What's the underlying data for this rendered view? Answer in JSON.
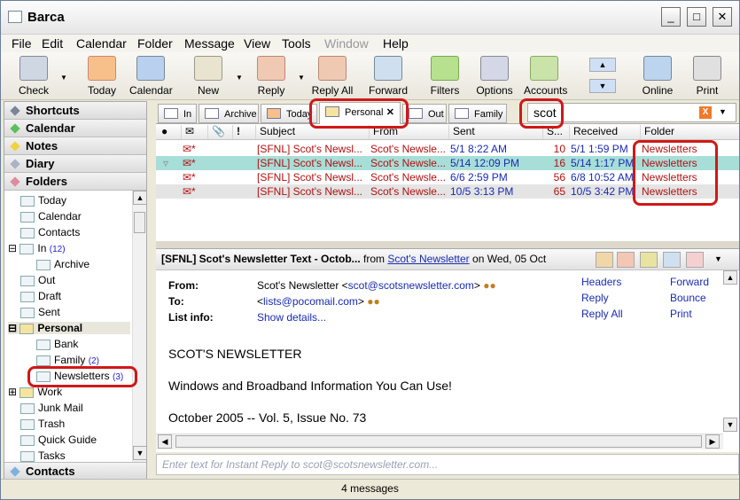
{
  "window": {
    "title": "Barca"
  },
  "menu": [
    "File",
    "Edit",
    "Calendar",
    "Folder",
    "Message",
    "View",
    "Tools",
    "Window",
    "Help"
  ],
  "toolbar": {
    "check": "Check",
    "today": "Today",
    "calendar": "Calendar",
    "new": "New",
    "reply": "Reply",
    "reply_all": "Reply All",
    "forward": "Forward",
    "filters": "Filters",
    "options": "Options",
    "accounts": "Accounts",
    "online": "Online",
    "print": "Print"
  },
  "sidebar": {
    "sections": [
      "Shortcuts",
      "Calendar",
      "Notes",
      "Diary",
      "Folders"
    ],
    "contacts": "Contacts",
    "tree": [
      {
        "label": "Today"
      },
      {
        "label": "Calendar"
      },
      {
        "label": "Contacts"
      },
      {
        "label": "In",
        "count": "(12)"
      },
      {
        "label": "Archive"
      },
      {
        "label": "Out"
      },
      {
        "label": "Draft"
      },
      {
        "label": "Sent"
      },
      {
        "label": "Personal"
      },
      {
        "label": "Bank"
      },
      {
        "label": "Family",
        "count": "(2)"
      },
      {
        "label": "Newsletters",
        "count": "(3)"
      },
      {
        "label": "Work"
      },
      {
        "label": "Junk Mail"
      },
      {
        "label": "Trash"
      },
      {
        "label": "Quick Guide"
      },
      {
        "label": "Tasks"
      }
    ]
  },
  "tabs": [
    "In",
    "Archive",
    "Today",
    "Personal",
    "Out",
    "Family"
  ],
  "search": {
    "value": "scot"
  },
  "columns": {
    "subject": "Subject",
    "from": "From",
    "sent": "Sent",
    "size": "S...",
    "received": "Received",
    "folder": "Folder"
  },
  "messages": [
    {
      "subject": "[SFNL] Scot's Newsl...",
      "from": "Scot's Newsle...",
      "sent": "5/1 8:22 AM",
      "size": "10",
      "received": "5/1 1:59 PM",
      "folder": "Newsletters"
    },
    {
      "subject": "[SFNL] Scot's Newsl...",
      "from": "Scot's Newsle...",
      "sent": "5/14 12:09 PM",
      "size": "16",
      "received": "5/14 1:17 PM",
      "folder": "Newsletters"
    },
    {
      "subject": "[SFNL] Scot's Newsl...",
      "from": "Scot's Newsle...",
      "sent": "6/6 2:59 PM",
      "size": "56",
      "received": "6/8 10:52 AM",
      "folder": "Newsletters"
    },
    {
      "subject": "[SFNL] Scot's Newsl...",
      "from": "Scot's Newsle...",
      "sent": "10/5 3:13 PM",
      "size": "65",
      "received": "10/5 3:42 PM",
      "folder": "Newsletters"
    }
  ],
  "preview": {
    "subject": "[SFNL] Scot's Newsletter Text - Octob...",
    "from_word": "from",
    "sender": "Scot's Newsletter",
    "on_text": "on Wed, 05 Oct",
    "from_label": "From:",
    "from_name": "Scot's Newsletter <",
    "from_email": "scot@scotsnewsletter.com",
    ">": ">",
    "to_label": "To:",
    "to_prefix": "<",
    "to_email": "lists@pocomail.com",
    "to_suffix": ">",
    "info_label": "List info:",
    "info_link": "Show details...",
    "actions": [
      "Headers",
      "Forward",
      "Reply",
      "Bounce",
      "Reply All",
      "Print"
    ],
    "body": [
      "SCOT'S NEWSLETTER",
      "Windows and Broadband Information You Can Use!",
      "October 2005 -- Vol. 5, Issue No. 73"
    ]
  },
  "reply_placeholder": "Enter text for Instant Reply to scot@scotsnewsletter.com...",
  "status": "4 messages"
}
